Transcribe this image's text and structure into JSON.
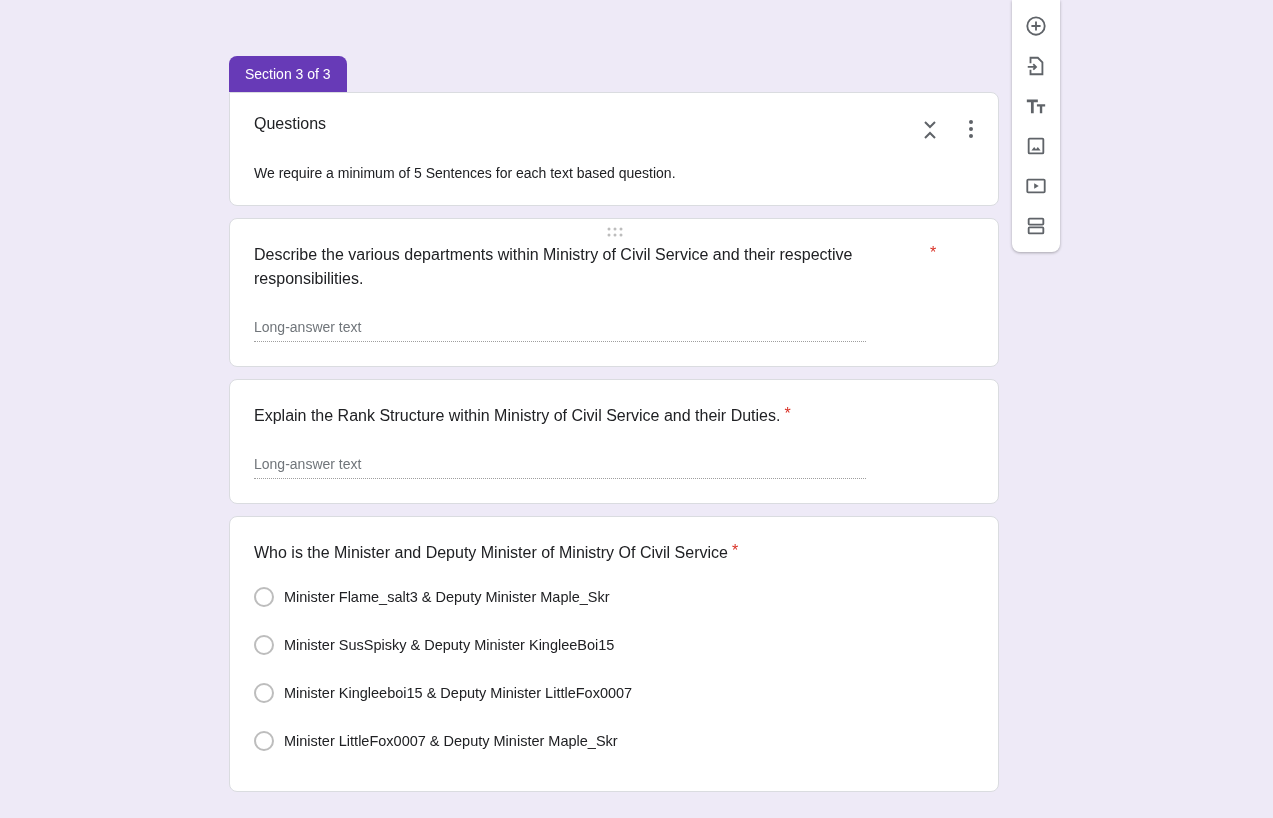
{
  "section_tab": {
    "label": "Section 3 of 3"
  },
  "section": {
    "title": "Questions",
    "description": "We require a minimum of 5 Sentences for each text based question."
  },
  "questions": [
    {
      "kind": "paragraph",
      "title": "Describe the various departments within Ministry of Civil Service and their respective responsibilities.",
      "required_mark": "*",
      "placeholder": "Long-answer text",
      "drag_handle": true
    },
    {
      "kind": "paragraph",
      "title": "Explain the Rank Structure within Ministry of Civil Service and their Duties.",
      "required_mark": "*",
      "placeholder": "Long-answer text",
      "drag_handle": false
    },
    {
      "kind": "choice",
      "title": "Who is the Minister and Deputy Minister of Ministry Of Civil Service",
      "required_mark": "*",
      "drag_handle": false,
      "options": [
        {
          "label": "Minister Flame_salt3 & Deputy Minister Maple_Skr",
          "selected": false
        },
        {
          "label": "Minister SusSpisky & Deputy Minister KingleeBoi15",
          "selected": false
        },
        {
          "label": "Minister Kingleeboi15 & Deputy Minister LittleFox0007",
          "selected": false
        },
        {
          "label": "Minister LittleFox0007 & Deputy Minister Maple_Skr",
          "selected": false
        }
      ]
    }
  ],
  "toolbar": [
    {
      "kind": "add"
    },
    {
      "kind": "import"
    },
    {
      "kind": "title"
    },
    {
      "kind": "image"
    },
    {
      "kind": "video"
    },
    {
      "kind": "section"
    }
  ]
}
